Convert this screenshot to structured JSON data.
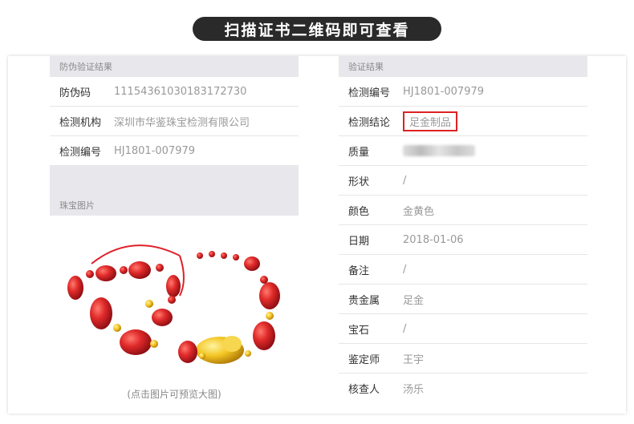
{
  "banner": "扫描证书二维码即可查看",
  "left": {
    "header": "防伪验证结果",
    "rows": [
      {
        "label": "防伪码",
        "value": "11154361030183172730"
      },
      {
        "label": "检测机构",
        "value": "深圳市华鉴珠宝检测有限公司"
      },
      {
        "label": "检测编号",
        "value": "HJ1801-007979"
      }
    ],
    "photo_header": "珠宝图片",
    "photo_caption": "(点击图片可预览大图)"
  },
  "right": {
    "header": "验证结果",
    "rows": [
      {
        "label": "检测编号",
        "value": "HJ1801-007979"
      },
      {
        "label": "检测结论",
        "value": "足金制品"
      },
      {
        "label": "质量",
        "value": ""
      },
      {
        "label": "形状",
        "value": "/"
      },
      {
        "label": "颜色",
        "value": "金黄色"
      },
      {
        "label": "日期",
        "value": "2018-01-06"
      },
      {
        "label": "备注",
        "value": "/"
      },
      {
        "label": "贵金属",
        "value": "足金"
      },
      {
        "label": "宝石",
        "value": "/"
      },
      {
        "label": "鉴定师",
        "value": "王宇"
      },
      {
        "label": "核查人",
        "value": "汤乐"
      }
    ]
  },
  "colors": {
    "highlight_border": "#d22222",
    "bead_red": "#d8262c",
    "gold": "#f3c623"
  }
}
